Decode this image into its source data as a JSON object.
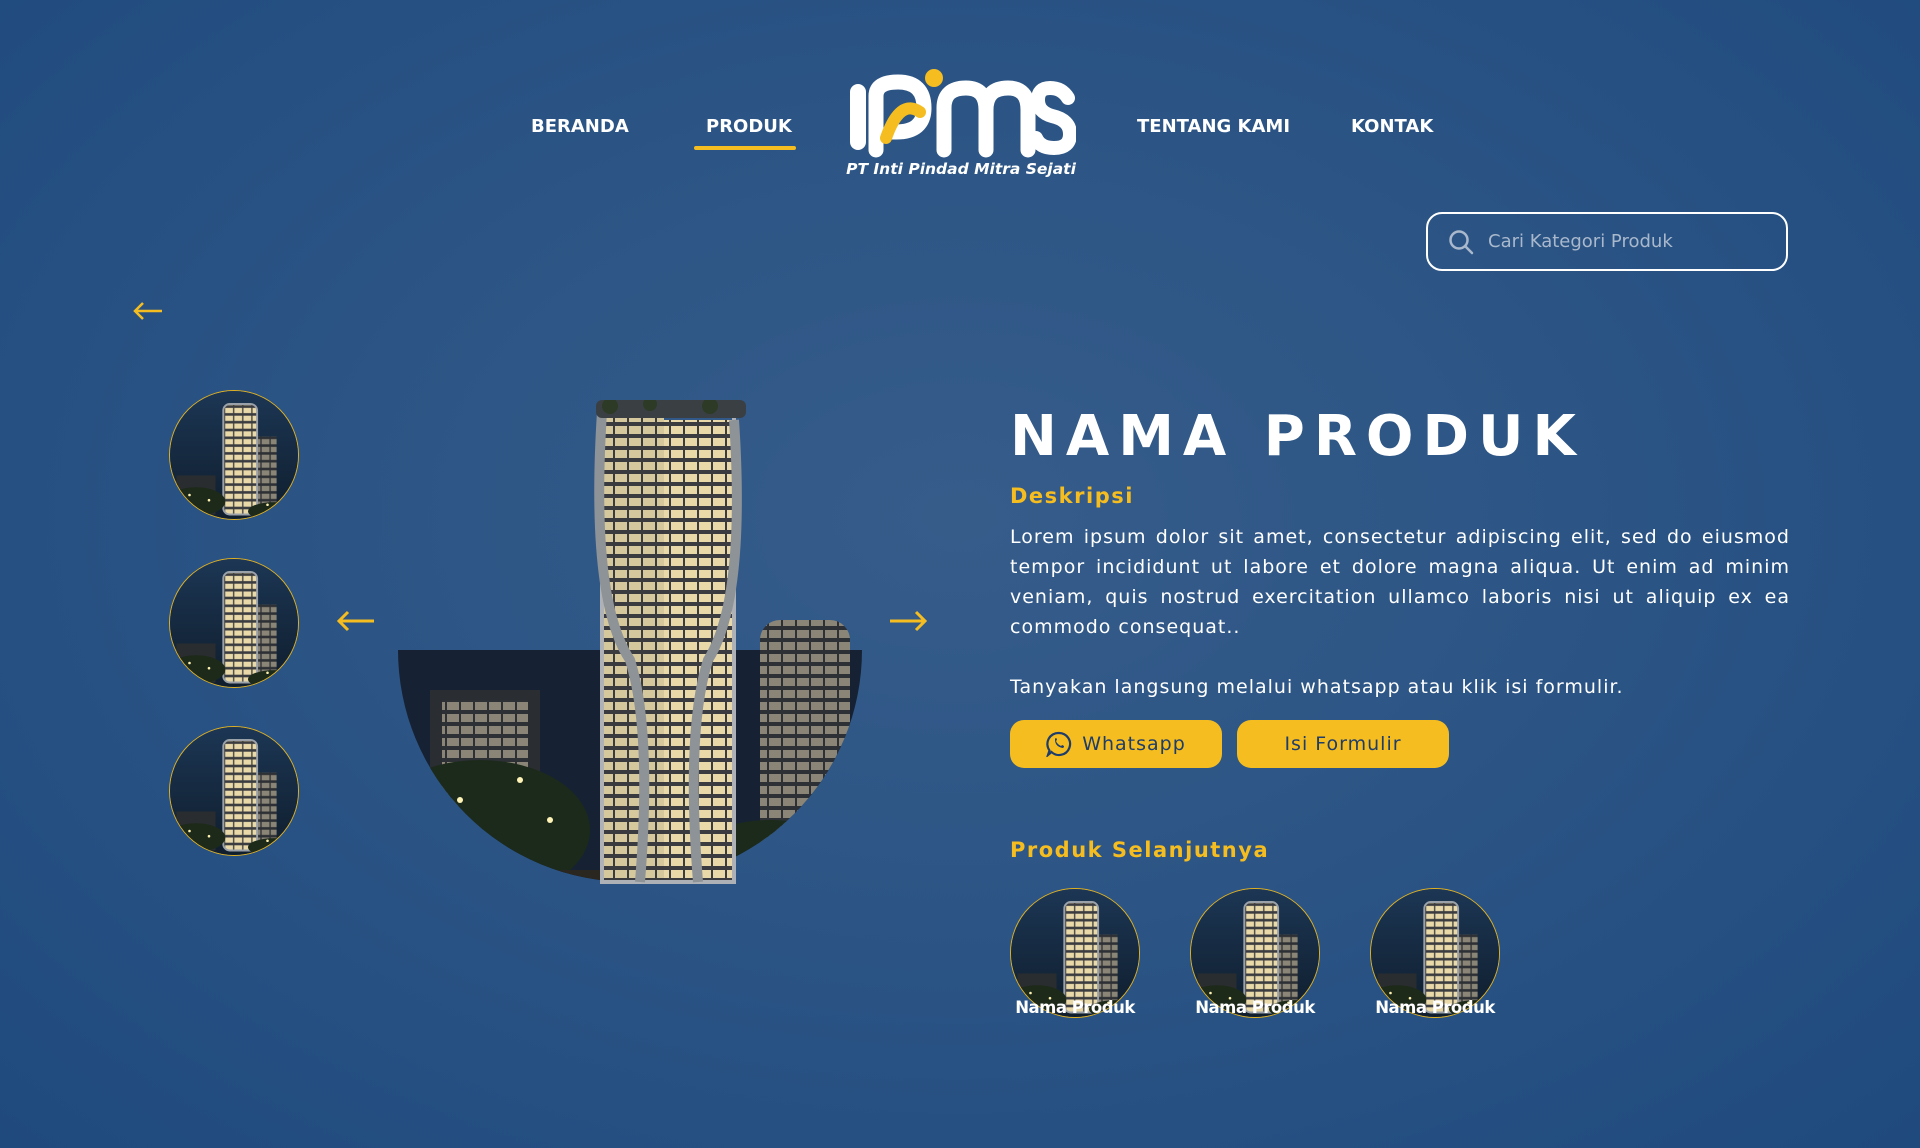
{
  "nav": {
    "left_links": [
      {
        "label": "BERANDA",
        "active": false
      },
      {
        "label": "PRODUK",
        "active": true
      }
    ],
    "right_links": [
      {
        "label": "TENTANG KAMI",
        "active": false
      },
      {
        "label": "KONTAK",
        "active": false
      }
    ],
    "logo": {
      "wordmark": "IPMS",
      "tagline": "PT Inti Pindad Mitra Sejati"
    }
  },
  "search": {
    "placeholder": "Cari Kategori Produk",
    "value": ""
  },
  "icons": {
    "back": "arrow-left-icon",
    "prev": "arrow-left-icon",
    "next": "arrow-right-icon",
    "search": "search-icon",
    "whatsapp": "whatsapp-icon"
  },
  "product": {
    "title": "NAMA PRODUK",
    "description_label": "Deskripsi",
    "description": "Lorem ipsum dolor sit amet, consectetur adipiscing elit, sed do eiusmod tempor incididunt ut labore et dolore magna aliqua. Ut enim ad minim veniam, quis nostrud exercitation ullamco laboris nisi ut aliquip ex ea commodo consequat..",
    "contact_prompt": "Tanyakan langsung melalui whatsapp atau klik isi formulir.",
    "whatsapp_label": "Whatsapp",
    "form_label": "Isi Formulir"
  },
  "next_products": {
    "heading": "Produk Selanjutnya",
    "items": [
      {
        "name": "Nama Produk"
      },
      {
        "name": "Nama Produk"
      },
      {
        "name": "Nama Produk"
      }
    ]
  },
  "colors": {
    "accent": "#f5bd1f",
    "background": "#2c5585",
    "text": "#ffffff"
  }
}
